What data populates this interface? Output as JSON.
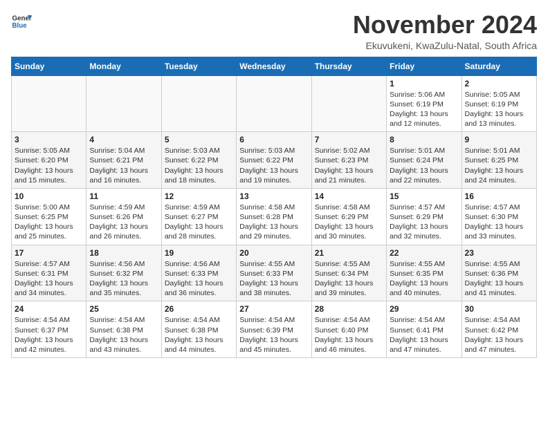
{
  "logo": {
    "general": "General",
    "blue": "Blue"
  },
  "title": "November 2024",
  "subtitle": "Ekuvukeni, KwaZulu-Natal, South Africa",
  "days_of_week": [
    "Sunday",
    "Monday",
    "Tuesday",
    "Wednesday",
    "Thursday",
    "Friday",
    "Saturday"
  ],
  "weeks": [
    [
      {
        "day": "",
        "info": ""
      },
      {
        "day": "",
        "info": ""
      },
      {
        "day": "",
        "info": ""
      },
      {
        "day": "",
        "info": ""
      },
      {
        "day": "",
        "info": ""
      },
      {
        "day": "1",
        "info": "Sunrise: 5:06 AM\nSunset: 6:19 PM\nDaylight: 13 hours and 12 minutes."
      },
      {
        "day": "2",
        "info": "Sunrise: 5:05 AM\nSunset: 6:19 PM\nDaylight: 13 hours and 13 minutes."
      }
    ],
    [
      {
        "day": "3",
        "info": "Sunrise: 5:05 AM\nSunset: 6:20 PM\nDaylight: 13 hours and 15 minutes."
      },
      {
        "day": "4",
        "info": "Sunrise: 5:04 AM\nSunset: 6:21 PM\nDaylight: 13 hours and 16 minutes."
      },
      {
        "day": "5",
        "info": "Sunrise: 5:03 AM\nSunset: 6:22 PM\nDaylight: 13 hours and 18 minutes."
      },
      {
        "day": "6",
        "info": "Sunrise: 5:03 AM\nSunset: 6:22 PM\nDaylight: 13 hours and 19 minutes."
      },
      {
        "day": "7",
        "info": "Sunrise: 5:02 AM\nSunset: 6:23 PM\nDaylight: 13 hours and 21 minutes."
      },
      {
        "day": "8",
        "info": "Sunrise: 5:01 AM\nSunset: 6:24 PM\nDaylight: 13 hours and 22 minutes."
      },
      {
        "day": "9",
        "info": "Sunrise: 5:01 AM\nSunset: 6:25 PM\nDaylight: 13 hours and 24 minutes."
      }
    ],
    [
      {
        "day": "10",
        "info": "Sunrise: 5:00 AM\nSunset: 6:25 PM\nDaylight: 13 hours and 25 minutes."
      },
      {
        "day": "11",
        "info": "Sunrise: 4:59 AM\nSunset: 6:26 PM\nDaylight: 13 hours and 26 minutes."
      },
      {
        "day": "12",
        "info": "Sunrise: 4:59 AM\nSunset: 6:27 PM\nDaylight: 13 hours and 28 minutes."
      },
      {
        "day": "13",
        "info": "Sunrise: 4:58 AM\nSunset: 6:28 PM\nDaylight: 13 hours and 29 minutes."
      },
      {
        "day": "14",
        "info": "Sunrise: 4:58 AM\nSunset: 6:29 PM\nDaylight: 13 hours and 30 minutes."
      },
      {
        "day": "15",
        "info": "Sunrise: 4:57 AM\nSunset: 6:29 PM\nDaylight: 13 hours and 32 minutes."
      },
      {
        "day": "16",
        "info": "Sunrise: 4:57 AM\nSunset: 6:30 PM\nDaylight: 13 hours and 33 minutes."
      }
    ],
    [
      {
        "day": "17",
        "info": "Sunrise: 4:57 AM\nSunset: 6:31 PM\nDaylight: 13 hours and 34 minutes."
      },
      {
        "day": "18",
        "info": "Sunrise: 4:56 AM\nSunset: 6:32 PM\nDaylight: 13 hours and 35 minutes."
      },
      {
        "day": "19",
        "info": "Sunrise: 4:56 AM\nSunset: 6:33 PM\nDaylight: 13 hours and 36 minutes."
      },
      {
        "day": "20",
        "info": "Sunrise: 4:55 AM\nSunset: 6:33 PM\nDaylight: 13 hours and 38 minutes."
      },
      {
        "day": "21",
        "info": "Sunrise: 4:55 AM\nSunset: 6:34 PM\nDaylight: 13 hours and 39 minutes."
      },
      {
        "day": "22",
        "info": "Sunrise: 4:55 AM\nSunset: 6:35 PM\nDaylight: 13 hours and 40 minutes."
      },
      {
        "day": "23",
        "info": "Sunrise: 4:55 AM\nSunset: 6:36 PM\nDaylight: 13 hours and 41 minutes."
      }
    ],
    [
      {
        "day": "24",
        "info": "Sunrise: 4:54 AM\nSunset: 6:37 PM\nDaylight: 13 hours and 42 minutes."
      },
      {
        "day": "25",
        "info": "Sunrise: 4:54 AM\nSunset: 6:38 PM\nDaylight: 13 hours and 43 minutes."
      },
      {
        "day": "26",
        "info": "Sunrise: 4:54 AM\nSunset: 6:38 PM\nDaylight: 13 hours and 44 minutes."
      },
      {
        "day": "27",
        "info": "Sunrise: 4:54 AM\nSunset: 6:39 PM\nDaylight: 13 hours and 45 minutes."
      },
      {
        "day": "28",
        "info": "Sunrise: 4:54 AM\nSunset: 6:40 PM\nDaylight: 13 hours and 46 minutes."
      },
      {
        "day": "29",
        "info": "Sunrise: 4:54 AM\nSunset: 6:41 PM\nDaylight: 13 hours and 47 minutes."
      },
      {
        "day": "30",
        "info": "Sunrise: 4:54 AM\nSunset: 6:42 PM\nDaylight: 13 hours and 47 minutes."
      }
    ]
  ]
}
